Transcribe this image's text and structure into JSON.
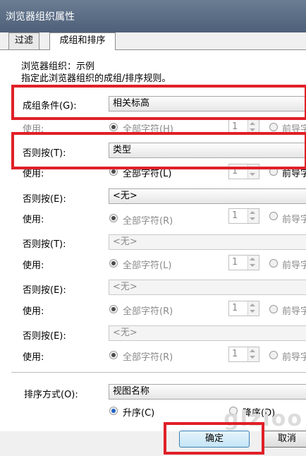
{
  "window": {
    "title": "浏览器组织属性"
  },
  "tabs": [
    {
      "label": "过滤"
    },
    {
      "label": "成组和排序"
    }
  ],
  "header": {
    "line1": "浏览器组织：示例",
    "line2": "指定此浏览器组织的成组/排序规则。"
  },
  "groups": [
    {
      "label": "成组条件(G):",
      "value": "相关标高",
      "enabled": true,
      "use_label": "使用:",
      "all_chars": "全部字符(H)",
      "count": "1",
      "prefix": "前导字"
    },
    {
      "label": "否则按(T):",
      "value": "类型",
      "enabled": true,
      "use_label": "使用:",
      "all_chars": "全部字符(L)",
      "count": "1",
      "prefix": "前导字"
    },
    {
      "label": "否则按(E):",
      "value": "<无>",
      "enabled": true,
      "use_label": "使用:",
      "all_chars": "全部字符(R)",
      "count": "1",
      "prefix": "前导字"
    },
    {
      "label": "否则按(T):",
      "value": "<无>",
      "enabled": false,
      "use_label": "使用:",
      "all_chars": "全部字符(L)",
      "count": "1",
      "prefix": "前导字"
    },
    {
      "label": "否则按(E):",
      "value": "<无>",
      "enabled": false,
      "use_label": "使用:",
      "all_chars": "全部字符(R)",
      "count": "1",
      "prefix": "前导字"
    },
    {
      "label": "否则按(E):",
      "value": "<无>",
      "enabled": false,
      "use_label": "使用:",
      "all_chars": "全部字符(R)",
      "count": "1",
      "prefix": "前导字"
    }
  ],
  "sort": {
    "label": "排序方式(O):",
    "value": "视图名称",
    "asc": "升序(C)",
    "desc": "降序(D)"
  },
  "buttons": {
    "ok": "确定",
    "cancel": "取消"
  },
  "watermark": "glzioo",
  "colors": {
    "highlight_box": "#e02027",
    "titlebar": "#5a6c84"
  }
}
